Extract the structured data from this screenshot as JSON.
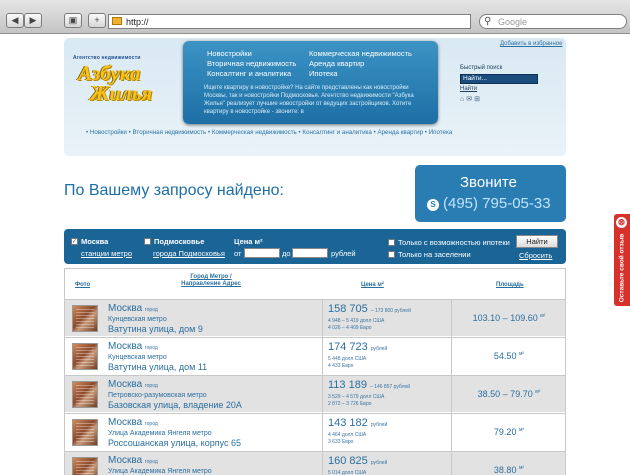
{
  "browser": {
    "back": "◀",
    "forward": "▶",
    "url": "http://",
    "search_placeholder": "Google"
  },
  "header": {
    "logo": {
      "subtitle": "Агентство недвижимости",
      "line1": "Азбука",
      "line2": "Жилья"
    },
    "popup": {
      "links_left": [
        "Новостройки",
        "Вторичная недвижимость",
        "Консалтинг и аналитика"
      ],
      "links_right": [
        "Коммерческая недвижимость",
        "Аренда квартир",
        "Ипотека"
      ],
      "description": "Ищете квартиру в новостройке? На сайте представлены как новостройки Москвы, так и новостройки Подмосковья. Агентство недвижимости \"Азбука Жилья\" реализует лучшие новостройки от ведущих застройщиков. Хотите квартиру в новостройке - звоните: в"
    },
    "add_favorites": "Добавить в избранное",
    "quick_search": {
      "label": "Быстрый поиск",
      "input_value": "Найти...",
      "go": "Найти"
    },
    "breadcrumbs": [
      "Новостройки",
      "Вторичная недвижимость",
      "Коммерческая недвижимость",
      "Консалтинг и аналитика",
      "Аренда квартир",
      "Ипотека"
    ]
  },
  "found_title": "По Вашему запросу найдено:",
  "call": {
    "title": "Звоните",
    "phone": "(495) 795-05-33"
  },
  "filter": {
    "moscow": "Москва",
    "moscow_checked": true,
    "moscow_link": "станции метро",
    "region": "Подмосковье",
    "region_link": "города Подмосковья",
    "price_label": "Цена м²",
    "from": "от",
    "to": "до",
    "currency": "рублей",
    "mortgage": "Только с возможностью ипотеки",
    "settled": "Только на заселении",
    "search_button": "Найти",
    "reset": "Сбросить"
  },
  "table": {
    "headers": {
      "photo": "Фото",
      "location": "Город Метро / Направление Адрес",
      "price": "Цена м²",
      "area": "Площадь"
    },
    "rows": [
      {
        "city": "Москва",
        "city_type": "город",
        "metro": "Кунцевская метро",
        "address": "Ватутина улица, дом 9",
        "price": "158 705",
        "price_max": "– 173 800 рублей",
        "usd": "4 948 – 5 419 долл США",
        "eur": "4 026 – 4 409 Евро",
        "area": "103.10 – 109.60"
      },
      {
        "city": "Москва",
        "city_type": "город",
        "metro": "Кунцевская метро",
        "address": "Ватутина улица, дом 11",
        "price": "174 723",
        "price_max": "рублей",
        "usd": "5 448 долл США",
        "eur": "4 433 Евро",
        "area": "54.50"
      },
      {
        "city": "Москва",
        "city_type": "город",
        "metro": "Петровско-разумовская метро",
        "address": "Базовская улица, владение 20А",
        "price": "113 189",
        "price_max": "– 146 857 рублей",
        "usd": "3 529 – 4 579 долл США",
        "eur": "2 872 – 3 726 Евро",
        "area": "38.50 – 79.70"
      },
      {
        "city": "Москва",
        "city_type": "город",
        "metro": "Улица Академика Янгеля метро",
        "address": "Россошанская улица, корпус 65",
        "price": "143 182",
        "price_max": "рублей",
        "usd": "4 464 долл США",
        "eur": "3 633 Евро",
        "area": "79.20"
      },
      {
        "city": "Москва",
        "city_type": "город",
        "metro": "Улица Академика Янгеля метро",
        "address": "",
        "price": "160 825",
        "price_max": "рублей",
        "usd": "5 014 долл США",
        "eur": "",
        "area": "38.80"
      }
    ],
    "area_unit": "м²"
  },
  "side_tab": "Оставьте свой отзыв"
}
